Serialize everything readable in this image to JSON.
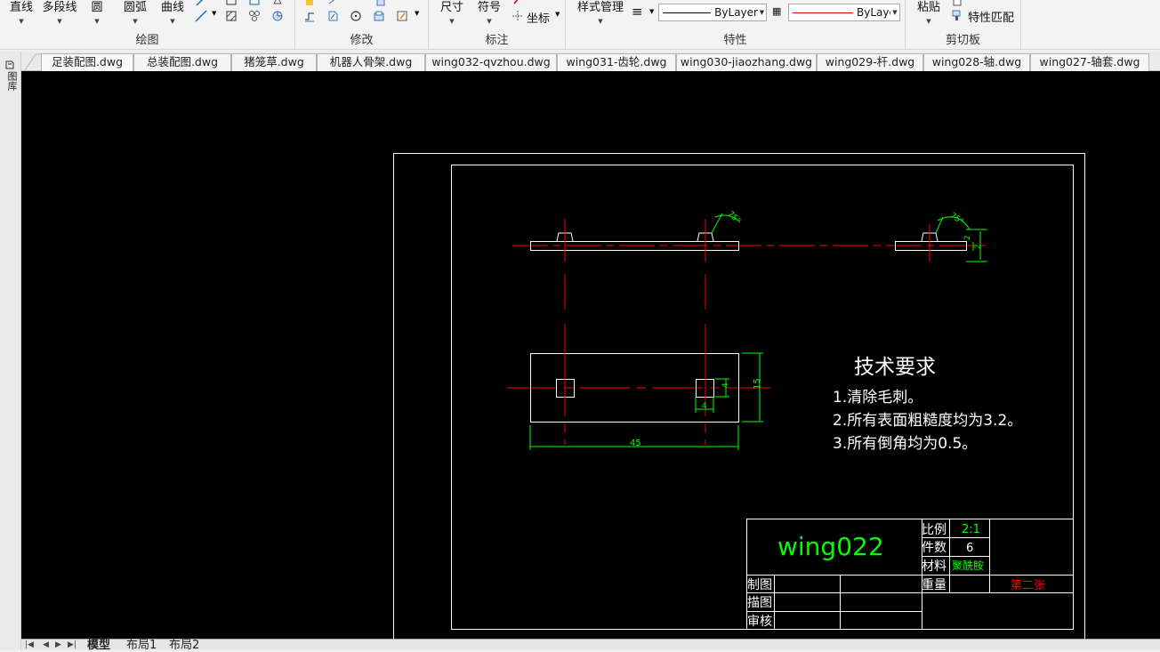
{
  "ribbon": {
    "draw": {
      "line": "直线",
      "polyline": "多段线",
      "circle": "圆",
      "arc": "圆弧",
      "curve": "曲线",
      "title": "绘图"
    },
    "modify": {
      "title": "修改"
    },
    "annotate": {
      "dimension": "尺寸",
      "symbol": "符号",
      "coordinate": "坐标",
      "title": "标注"
    },
    "properties": {
      "style_manager": "样式管理",
      "linetype_value": "ByLayer",
      "color_value": "ByLayer",
      "title": "特性"
    },
    "clipboard": {
      "paste": "粘贴",
      "match_props": "特性匹配",
      "title": "剪切板"
    }
  },
  "side": {
    "label": "图库"
  },
  "tabs": [
    "足装配图.dwg",
    "总装配图.dwg",
    "猪笼草.dwg",
    "机器人骨架.dwg",
    "wing032-qvzhou.dwg",
    "wing031-齿轮.dwg",
    "wing030-jiaozhang.dwg",
    "wing029-杆.dwg",
    "wing028-轴.dwg",
    "wing027-轴套.dwg"
  ],
  "drawing": {
    "tech_title": "技术要求",
    "tech_items": [
      "1.清除毛刺。",
      "2.所有表面粗糙度均为3.2。",
      "3.所有倒角均为0.5。"
    ],
    "dims": {
      "length": "45",
      "height": "15",
      "hole_w": "4",
      "hole_h": "4",
      "angle1": "75°",
      "angle2": "75°",
      "depth": "2",
      "thick": "2"
    },
    "title_block": {
      "name": "wing022",
      "scale_label": "比例",
      "scale_value": "2:1",
      "count_label": "件数",
      "count_value": "6",
      "material_label": "材料",
      "material_value": "聚酰胺",
      "weight_label": "重量",
      "sheet": "第二张",
      "drawn_label": "制图",
      "traced_label": "描图",
      "checked_label": "审核"
    }
  },
  "layout_tabs": [
    "模型",
    "布局1",
    "布局2"
  ],
  "colors": {
    "canvas": "#000000",
    "frame": "#ffffff",
    "center": "#ff0000",
    "dimension": "#00ff00",
    "outline": "#ffffff",
    "title_text": "#00ff00",
    "sheet_text": "#ff0000"
  }
}
